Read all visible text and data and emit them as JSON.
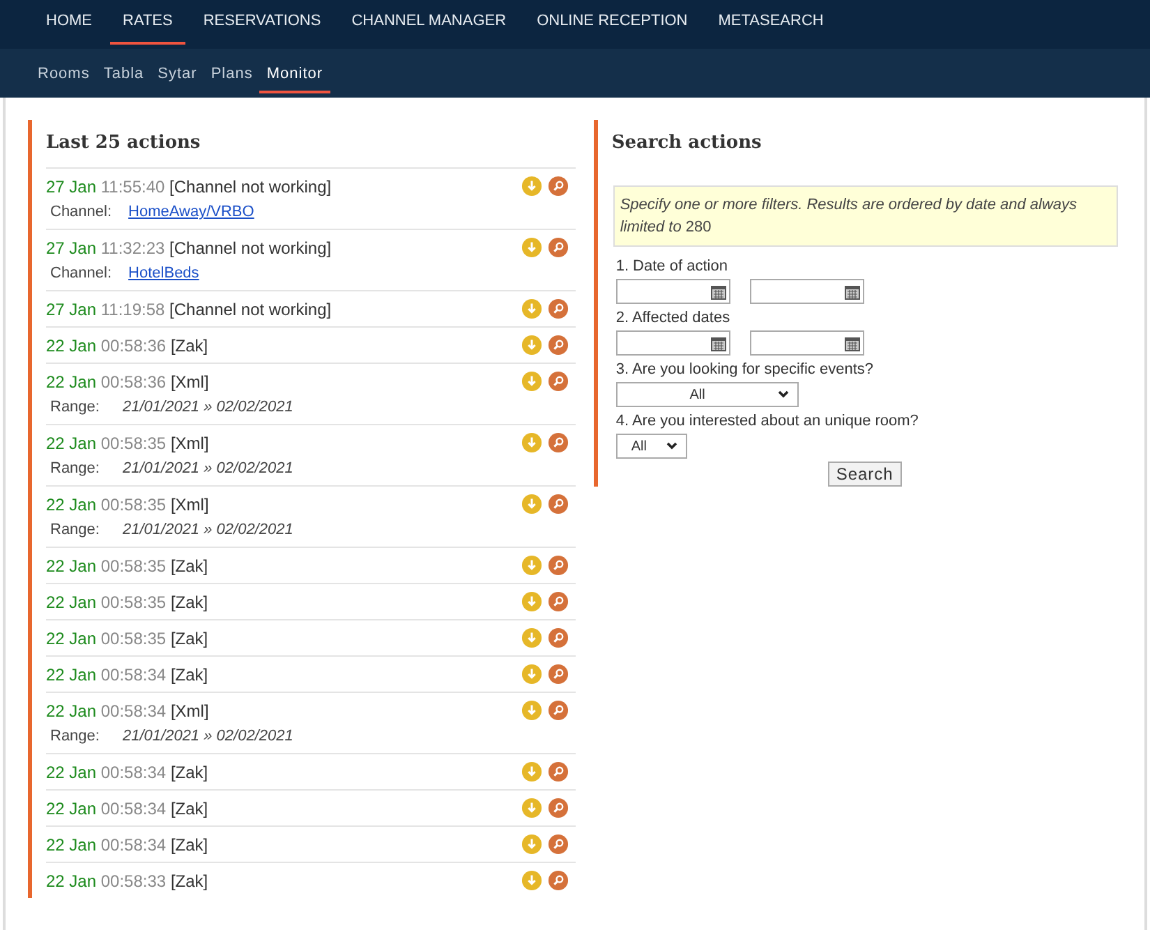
{
  "top_nav": [
    {
      "label": "HOME",
      "selected": false
    },
    {
      "label": "RATES",
      "selected": true
    },
    {
      "label": "RESERVATIONS",
      "selected": false
    },
    {
      "label": "CHANNEL MANAGER",
      "selected": false
    },
    {
      "label": "ONLINE RECEPTION",
      "selected": false
    },
    {
      "label": "METASEARCH",
      "selected": false
    }
  ],
  "sub_nav": [
    {
      "label": "Rooms",
      "selected": false
    },
    {
      "label": "Tabla",
      "selected": false
    },
    {
      "label": "Sytar",
      "selected": false
    },
    {
      "label": "Plans",
      "selected": false
    },
    {
      "label": "Monitor",
      "selected": true
    }
  ],
  "actions_panel": {
    "title": "Last 25 actions",
    "rows": [
      {
        "date": "27 Jan",
        "time": "11:55:40",
        "event": "[Channel not working]",
        "detail": {
          "kind": "link",
          "label": "Channel:",
          "value": "HomeAway/VRBO"
        }
      },
      {
        "date": "27 Jan",
        "time": "11:32:23",
        "event": "[Channel not working]",
        "detail": {
          "kind": "link",
          "label": "Channel:",
          "value": "HotelBeds"
        }
      },
      {
        "date": "27 Jan",
        "time": "11:19:58",
        "event": "[Channel not working]"
      },
      {
        "date": "22 Jan",
        "time": "00:58:36",
        "event": "[Zak]"
      },
      {
        "date": "22 Jan",
        "time": "00:58:36",
        "event": "[Xml]",
        "detail": {
          "kind": "range",
          "label": "Range:",
          "value": "21/01/2021 » 02/02/2021"
        }
      },
      {
        "date": "22 Jan",
        "time": "00:58:35",
        "event": "[Xml]",
        "detail": {
          "kind": "range",
          "label": "Range:",
          "value": "21/01/2021 » 02/02/2021"
        }
      },
      {
        "date": "22 Jan",
        "time": "00:58:35",
        "event": "[Xml]",
        "detail": {
          "kind": "range",
          "label": "Range:",
          "value": "21/01/2021 » 02/02/2021"
        }
      },
      {
        "date": "22 Jan",
        "time": "00:58:35",
        "event": "[Zak]"
      },
      {
        "date": "22 Jan",
        "time": "00:58:35",
        "event": "[Zak]"
      },
      {
        "date": "22 Jan",
        "time": "00:58:35",
        "event": "[Zak]"
      },
      {
        "date": "22 Jan",
        "time": "00:58:34",
        "event": "[Zak]"
      },
      {
        "date": "22 Jan",
        "time": "00:58:34",
        "event": "[Xml]",
        "detail": {
          "kind": "range",
          "label": "Range:",
          "value": "21/01/2021 » 02/02/2021"
        }
      },
      {
        "date": "22 Jan",
        "time": "00:58:34",
        "event": "[Zak]"
      },
      {
        "date": "22 Jan",
        "time": "00:58:34",
        "event": "[Zak]"
      },
      {
        "date": "22 Jan",
        "time": "00:58:34",
        "event": "[Zak]"
      },
      {
        "date": "22 Jan",
        "time": "00:58:33",
        "event": "[Zak]"
      }
    ]
  },
  "search_panel": {
    "title": "Search actions",
    "notice": "*Specify one or more filters. Results are ordered by date and always limited to* 280",
    "filters": [
      {
        "kind": "dates",
        "label": "1. Date of action"
      },
      {
        "kind": "dates",
        "label": "2. Affected dates"
      },
      {
        "kind": "select",
        "label": "3. Are you looking for specific events?",
        "value": "All",
        "wide": true
      },
      {
        "kind": "select",
        "label": "4. Are you interested about an unique room?",
        "value": "All",
        "wide": false
      }
    ],
    "button": "Search"
  }
}
